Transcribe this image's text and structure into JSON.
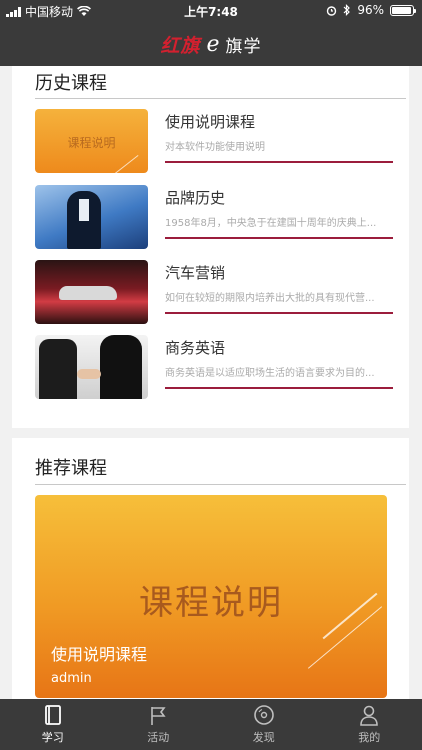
{
  "status_bar": {
    "carrier": "中国移动",
    "time": "上午7:48",
    "battery": "96%",
    "battery_level": 0.96
  },
  "header": {
    "logo_script": "红旗",
    "logo_e": "e",
    "logo_text": "旗学"
  },
  "history": {
    "title": "历史课程",
    "courses": [
      {
        "title": "使用说明课程",
        "desc": "对本软件功能使用说明",
        "thumb_label": "课程说明"
      },
      {
        "title": "品牌历史",
        "desc": "1958年8月，中央急于在建国十周年的庆典上..."
      },
      {
        "title": "汽车营销",
        "desc": "如何在较短的期限内培养出大批的具有现代营..."
      },
      {
        "title": "商务英语",
        "desc": "商务英语是以适应职场生活的语言要求为目的..."
      }
    ]
  },
  "recommend": {
    "title": "推荐课程",
    "banner_text": "课程说明",
    "course_title": "使用说明课程",
    "author": "admin"
  },
  "tabs": [
    {
      "label": "学习",
      "icon": "book-icon",
      "active": true
    },
    {
      "label": "活动",
      "icon": "flag-icon",
      "active": false
    },
    {
      "label": "发现",
      "icon": "disc-icon",
      "active": false
    },
    {
      "label": "我的",
      "icon": "user-icon",
      "active": false
    }
  ],
  "colors": {
    "bar_bg": "#3a3a3a",
    "accent_line": "#9b1d3c",
    "logo_red": "#d2202f",
    "banner_orange": "#f09a24"
  }
}
